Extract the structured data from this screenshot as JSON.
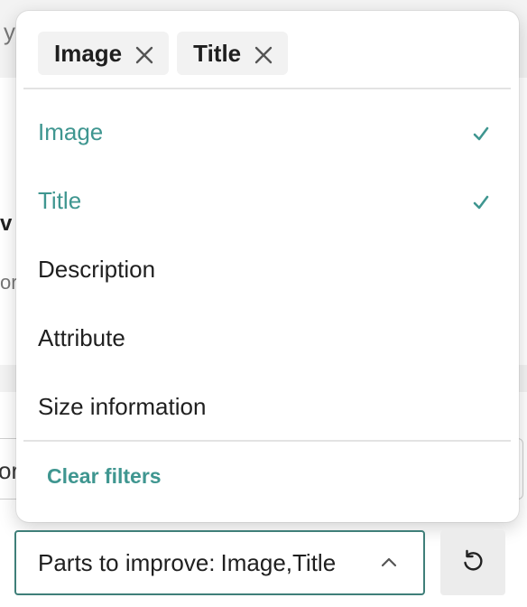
{
  "popover": {
    "chips": [
      {
        "label": "Image"
      },
      {
        "label": "Title"
      }
    ],
    "options": [
      {
        "label": "Image",
        "selected": true
      },
      {
        "label": "Title",
        "selected": true
      },
      {
        "label": "Description",
        "selected": false
      },
      {
        "label": "Attribute",
        "selected": false
      },
      {
        "label": "Size information",
        "selected": false
      }
    ],
    "clear_filters_label": "Clear filters"
  },
  "filter_select": {
    "label": "Parts to improve:",
    "value": "Image,Title"
  },
  "background": {
    "fragment_1": "y",
    "fragment_2": "v",
    "fragment_3": "or",
    "fragment_4": "or"
  },
  "colors": {
    "accent": "#3f9690",
    "select_border": "#3f7f79",
    "chip_bg": "#f2f2f2",
    "reset_bg": "#ececec"
  },
  "icons": {
    "chip_remove": "close-icon",
    "selected_mark": "check-icon",
    "select_toggle": "chevron-up-icon",
    "reset": "reset-icon"
  }
}
